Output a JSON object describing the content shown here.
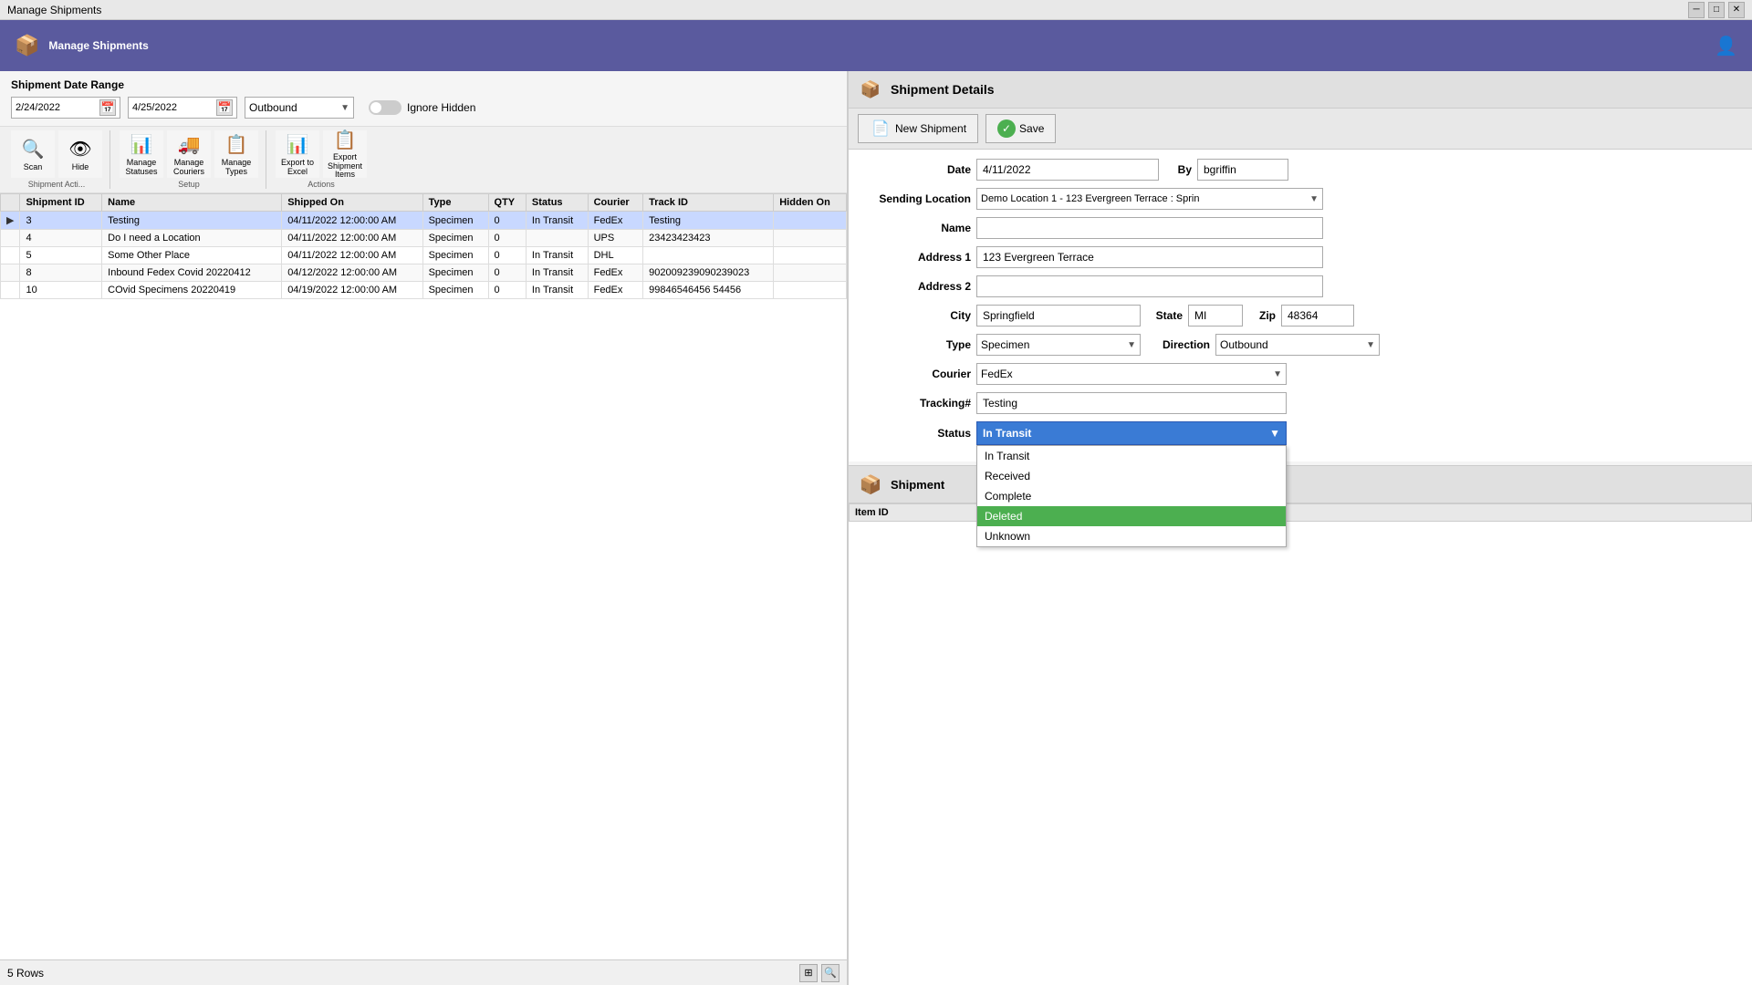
{
  "window": {
    "title": "Manage Shipments"
  },
  "app_header": {
    "title": "Manage Shipments",
    "icon": "📦"
  },
  "filter_bar": {
    "title": "Shipment Date Range",
    "start_date": "2/24/2022",
    "end_date": "4/25/2022",
    "direction": "Outbound",
    "ignore_hidden_label": "Ignore Hidden"
  },
  "toolbar": {
    "groups": [
      {
        "label": "Shipment Acti...",
        "buttons": [
          {
            "icon": "🔍",
            "label": "Scan"
          },
          {
            "icon": "👁",
            "label": "Hide"
          }
        ]
      },
      {
        "label": "Setup",
        "buttons": [
          {
            "icon": "📊",
            "label": "Manage\nStatuses"
          },
          {
            "icon": "🚚",
            "label": "Manage\nCouriers"
          },
          {
            "icon": "📋",
            "label": "Manage\nTypes"
          }
        ]
      },
      {
        "label": "Actions",
        "buttons": [
          {
            "icon": "📊",
            "label": "Export\nto Excel"
          },
          {
            "icon": "📋",
            "label": "Export\nShipment Items"
          }
        ]
      }
    ]
  },
  "table": {
    "columns": [
      "Shipment ID",
      "Name",
      "Shipped On",
      "Type",
      "QTY",
      "Status",
      "Courier",
      "Track ID",
      "Hidden On"
    ],
    "rows": [
      {
        "id": "3",
        "name": "Testing",
        "shipped_on": "04/11/2022 12:00:00 AM",
        "type": "Specimen",
        "qty": "0",
        "status": "In Transit",
        "courier": "FedEx",
        "track_id": "Testing",
        "hidden_on": "",
        "selected": true
      },
      {
        "id": "4",
        "name": "Do I need a Location",
        "shipped_on": "04/11/2022 12:00:00 AM",
        "type": "Specimen",
        "qty": "0",
        "status": "",
        "courier": "UPS",
        "track_id": "23423423423",
        "hidden_on": ""
      },
      {
        "id": "5",
        "name": "Some Other Place",
        "shipped_on": "04/11/2022 12:00:00 AM",
        "type": "Specimen",
        "qty": "0",
        "status": "In Transit",
        "courier": "DHL",
        "track_id": "",
        "hidden_on": ""
      },
      {
        "id": "8",
        "name": "Inbound Fedex Covid 20220412",
        "shipped_on": "04/12/2022 12:00:00 AM",
        "type": "Specimen",
        "qty": "0",
        "status": "In Transit",
        "courier": "FedEx",
        "track_id": "902009239090239023",
        "hidden_on": ""
      },
      {
        "id": "10",
        "name": "COvid Specimens 20220419",
        "shipped_on": "04/19/2022 12:00:00 AM",
        "type": "Specimen",
        "qty": "0",
        "status": "In Transit",
        "courier": "FedEx",
        "track_id": "99846546456 54456",
        "hidden_on": ""
      }
    ]
  },
  "status_bar": {
    "rows_label": "5 Rows"
  },
  "right_panel": {
    "header_title": "Shipment Details",
    "new_shipment_label": "New Shipment",
    "save_label": "Save",
    "form": {
      "date_label": "Date",
      "date_value": "4/11/2022",
      "by_label": "By",
      "by_value": "bgriffin",
      "sending_location_label": "Sending Location",
      "sending_location_value": "Demo Location 1 - 123 Evergreen Terrace : Sprin",
      "name_label": "Name",
      "name_value": "",
      "address1_label": "Address 1",
      "address1_value": "123 Evergreen Terrace",
      "address2_label": "Address 2",
      "address2_value": "",
      "city_label": "City",
      "city_value": "Springfield",
      "state_label": "State",
      "state_value": "MI",
      "zip_label": "Zip",
      "zip_value": "48364",
      "type_label": "Type",
      "type_value": "Specimen",
      "direction_label": "Direction",
      "direction_value": "Outbound",
      "courier_label": "Courier",
      "courier_value": "FedEx",
      "tracking_label": "Tracking#",
      "tracking_value": "Testing",
      "status_label": "Status",
      "status_value": "In Transit"
    },
    "status_dropdown": {
      "options": [
        "In Transit",
        "Received",
        "Complete",
        "Deleted",
        "Unknown"
      ],
      "highlighted": "Deleted"
    },
    "shipment_items_title": "Shipment",
    "items_table": {
      "columns": [
        "Item ID"
      ]
    }
  }
}
